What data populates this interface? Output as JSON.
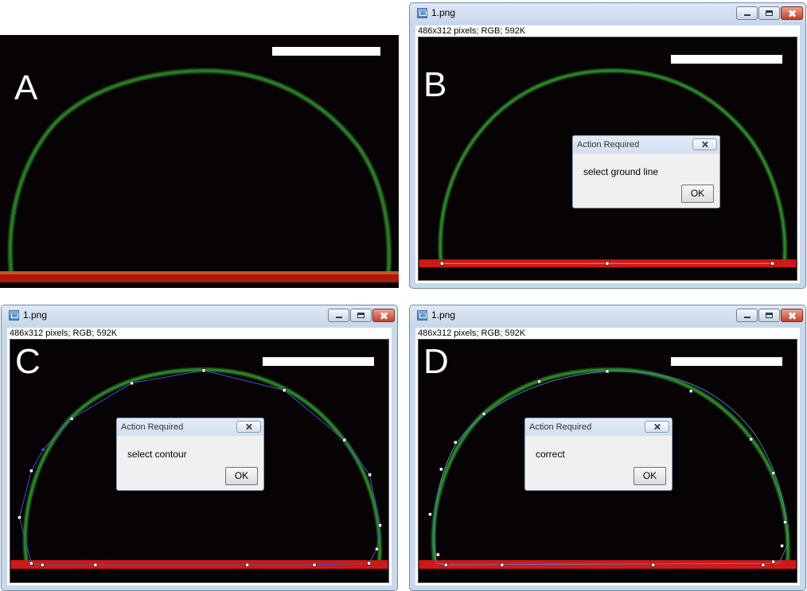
{
  "panels": {
    "A": {
      "letter": "A"
    },
    "B": {
      "letter": "B",
      "window": {
        "title": "1.png",
        "info": "486x312 pixels; RGB; 592K"
      },
      "dialog": {
        "title": "Action Required",
        "message": "select ground line",
        "ok_label": "OK"
      }
    },
    "C": {
      "letter": "C",
      "window": {
        "title": "1.png",
        "info": "486x312 pixels; RGB; 592K"
      },
      "dialog": {
        "title": "Action Required",
        "message": "select contour",
        "ok_label": "OK"
      }
    },
    "D": {
      "letter": "D",
      "window": {
        "title": "1.png",
        "info": "486x312 pixels; RGB; 592K"
      },
      "dialog": {
        "title": "Action Required",
        "message": "correct",
        "ok_label": "OK"
      }
    }
  },
  "colors": {
    "droplet_outline": "#2f8c2a",
    "ground_line": "#d01818",
    "selection_line": "#3a55d0",
    "scale_bar": "#ffffff"
  },
  "icons": {
    "window_app_icon": "imagej-app-icon",
    "minimize": "minimize-icon",
    "maximize": "maximize-icon",
    "close": "close-icon"
  }
}
